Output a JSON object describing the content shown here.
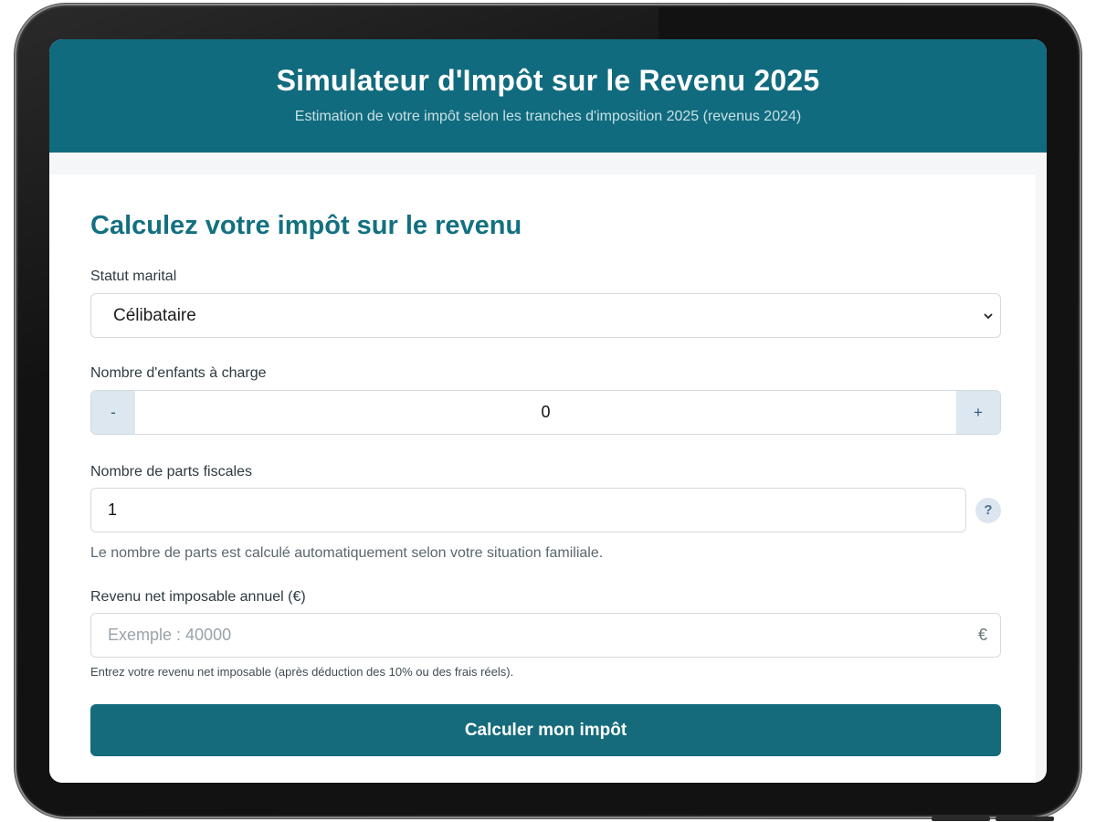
{
  "header": {
    "title": "Simulateur d'Impôt sur le Revenu 2025",
    "subtitle": "Estimation de votre impôt selon les tranches d'imposition 2025 (revenus 2024)"
  },
  "form": {
    "title": "Calculez votre impôt sur le revenu",
    "marital_status": {
      "label": "Statut marital",
      "selected": "Célibataire",
      "icon": "chevron-down-icon"
    },
    "children": {
      "label": "Nombre d'enfants à charge",
      "decrement_label": "-",
      "value": "0",
      "increment_label": "+"
    },
    "parts": {
      "label": "Nombre de parts fiscales",
      "value": "1",
      "help_icon_label": "?",
      "help_text": "Le nombre de parts est calculé automatiquement selon votre situation familiale."
    },
    "revenue": {
      "label": "Revenu net imposable annuel (€)",
      "placeholder": "Exemple : 40000",
      "currency": "€",
      "hint": "Entrez votre revenu net imposable (après déduction des 10% ou des frais réels)."
    },
    "submit_label": "Calculer mon impôt"
  },
  "colors": {
    "header_bg": "#116b7e",
    "title_color": "#137080",
    "button_bg": "#156b7c",
    "stepper_bg": "#dce7f0"
  }
}
